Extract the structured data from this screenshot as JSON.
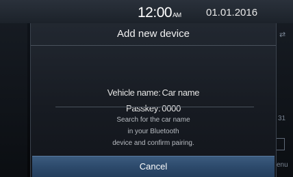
{
  "status_bar": {
    "time": "12:00",
    "ampm": "AM",
    "date": "01.01.2016"
  },
  "background": {
    "right_number": "31",
    "right_label": "enu"
  },
  "dialog": {
    "title": "Add new device",
    "vehicle_label": "Vehicle name:",
    "vehicle_value": "Car name",
    "passkey_label": "Passkey:",
    "passkey_value": "0000",
    "instructions": [
      "Search for the car name",
      "in your Bluetooth",
      "device and confirm pairing."
    ],
    "cancel_label": "Cancel"
  },
  "colors": {
    "accent": "#2d4a6c",
    "background": "#0a0d12",
    "dialog": "#1c2129"
  }
}
